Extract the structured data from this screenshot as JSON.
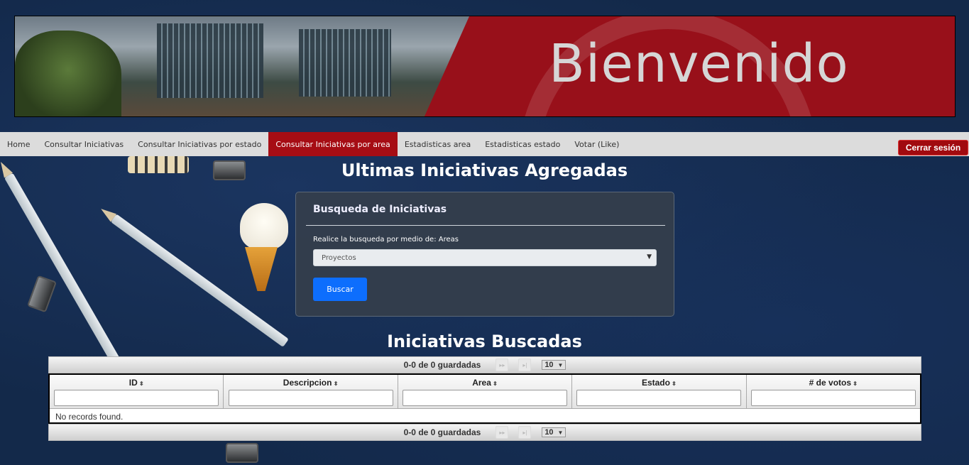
{
  "banner": {
    "title": "Bienvenido"
  },
  "nav": {
    "items": [
      {
        "label": "Home",
        "active": false
      },
      {
        "label": "Consultar Iniciativas",
        "active": false
      },
      {
        "label": "Consultar Iniciativas por estado",
        "active": false
      },
      {
        "label": "Consultar Iniciativas por area",
        "active": true
      },
      {
        "label": "Estadisticas area",
        "active": false
      },
      {
        "label": "Estadisticas estado",
        "active": false
      },
      {
        "label": "Votar (Like)",
        "active": false
      }
    ],
    "logout_label": "Cerrar sesión"
  },
  "main": {
    "title": "Ultimas Iniciativas Agregadas"
  },
  "search_card": {
    "title": "Busqueda de Iniciativas",
    "label": "Realice la busqueda por medio de: Areas",
    "selected": "Proyectos",
    "button": "Buscar"
  },
  "results": {
    "title": "Iniciativas Buscadas",
    "paginator_text": "0-0 de 0 guardadas",
    "rows_per_page": "10",
    "columns": [
      "ID",
      "Descripcion",
      "Area",
      "Estado",
      "# de votos"
    ],
    "empty_message": "No records found."
  },
  "icons": {
    "sort": "sort-icon",
    "select_arrow": "chevron-down-icon",
    "next_page": "next-page-icon",
    "last_page": "last-page-icon"
  },
  "colors": {
    "accent_red": "#a60d14",
    "button_blue": "#0d6efd",
    "background": "#13294a"
  }
}
